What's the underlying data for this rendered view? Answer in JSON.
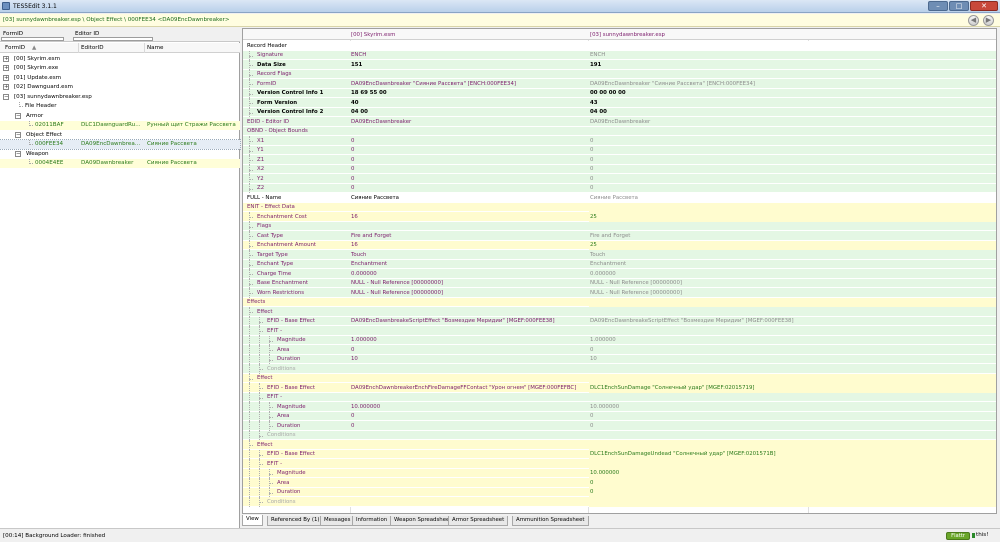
{
  "window": {
    "title": "TES5Edit 3.1.1",
    "min_label": "–",
    "max_label": "□",
    "close_label": "✕"
  },
  "pathbar": {
    "text": "[03] sunnydawnbreaker.esp \\ Object Effect \\ 000FEE34 <DA09EncDawnbreaker>",
    "back_label": "◀",
    "forward_label": "▶"
  },
  "filters": {
    "formid_label": "FormID",
    "editorid_label": "Editor ID",
    "formid_value": "",
    "editorid_value": ""
  },
  "tree_headers": {
    "formid": "FormID",
    "editorid": "EditorID",
    "name": "Name"
  },
  "tree": [
    {
      "formid": "[00] Skyrim.esm",
      "editorid": "",
      "name": "",
      "exp": "+"
    },
    {
      "formid": "[00] Skyrim.exe",
      "editorid": "",
      "name": "",
      "exp": "+"
    },
    {
      "formid": "[01] Update.esm",
      "editorid": "",
      "name": "",
      "exp": "+"
    },
    {
      "formid": "[02] Dawnguard.esm",
      "editorid": "",
      "name": "",
      "exp": "+"
    },
    {
      "formid": "[03] sunnydawnbreaker.esp",
      "editorid": "",
      "name": "",
      "exp": "−"
    },
    {
      "formid": "File Header",
      "editorid": "",
      "name": "",
      "exp": ""
    },
    {
      "formid": "Armor",
      "editorid": "",
      "name": "",
      "exp": "−"
    },
    {
      "formid": "02011BAF",
      "editorid": "DLC1DawnguardRu...",
      "name": "Рунный щит Стражи Рассвета",
      "exp": ""
    },
    {
      "formid": "Object Effect",
      "editorid": "",
      "name": "",
      "exp": "−"
    },
    {
      "formid": "000FEE34",
      "editorid": "DA09EncDawnbrea...",
      "name": "Сияние Рассвета",
      "exp": ""
    },
    {
      "formid": "Weapon",
      "editorid": "",
      "name": "",
      "exp": "−"
    },
    {
      "formid": "0004E4EE",
      "editorid": "DA09Dawnbreaker",
      "name": "Сияние Рассвета",
      "exp": ""
    }
  ],
  "record_headers": {
    "label": "",
    "file1": "[00] Skyrim.esm",
    "file2": "[03] sunnydawnbreaker.esp"
  },
  "records": [
    {
      "label": "Record Header",
      "v1": "",
      "v2": ""
    },
    {
      "label": "Signature",
      "v1": "ENCH",
      "v2": "ENCH"
    },
    {
      "label": "Data Size",
      "v1": "151",
      "v2": "191"
    },
    {
      "label": "Record Flags",
      "v1": "",
      "v2": ""
    },
    {
      "label": "FormID",
      "v1": "DA09EncDawnbreaker \"Сияние Рассвета\" [ENCH:000FEE34]",
      "v2": "DA09EncDawnbreaker \"Сияние Рассвета\" [ENCH:000FEE34]"
    },
    {
      "label": "Version Control Info 1",
      "v1": "18 69 55 00",
      "v2": "00 00 00 00"
    },
    {
      "label": "Form Version",
      "v1": "40",
      "v2": "43"
    },
    {
      "label": "Version Control Info 2",
      "v1": "04 00",
      "v2": "04 00"
    },
    {
      "label": "EDID - Editor ID",
      "v1": "DA09EncDawnbreaker",
      "v2": "DA09EncDawnbreaker"
    },
    {
      "label": "OBND - Object Bounds",
      "v1": "",
      "v2": ""
    },
    {
      "label": "X1",
      "v1": "0",
      "v2": "0"
    },
    {
      "label": "Y1",
      "v1": "0",
      "v2": "0"
    },
    {
      "label": "Z1",
      "v1": "0",
      "v2": "0"
    },
    {
      "label": "X2",
      "v1": "0",
      "v2": "0"
    },
    {
      "label": "Y2",
      "v1": "0",
      "v2": "0"
    },
    {
      "label": "Z2",
      "v1": "0",
      "v2": "0"
    },
    {
      "label": "FULL - Name",
      "v1": "Сияние Рассвета",
      "v2": "Сияние Рассвета"
    },
    {
      "label": "ENIT - Effect Data",
      "v1": "",
      "v2": ""
    },
    {
      "label": "Enchantment Cost",
      "v1": "16",
      "v2": "25"
    },
    {
      "label": "Flags",
      "v1": "",
      "v2": ""
    },
    {
      "label": "Cast Type",
      "v1": "Fire and Forget",
      "v2": "Fire and Forget"
    },
    {
      "label": "Enchantment Amount",
      "v1": "16",
      "v2": "25"
    },
    {
      "label": "Target Type",
      "v1": "Touch",
      "v2": "Touch"
    },
    {
      "label": "Enchant Type",
      "v1": "Enchantment",
      "v2": "Enchantment"
    },
    {
      "label": "Charge Time",
      "v1": "0.000000",
      "v2": "0.000000"
    },
    {
      "label": "Base Enchantment",
      "v1": "NULL - Null Reference [00000000]",
      "v2": "NULL - Null Reference [00000000]"
    },
    {
      "label": "Worn Restrictions",
      "v1": "NULL - Null Reference [00000000]",
      "v2": "NULL - Null Reference [00000000]"
    },
    {
      "label": "Effects",
      "v1": "",
      "v2": ""
    },
    {
      "label": "Effect",
      "v1": "",
      "v2": ""
    },
    {
      "label": "EFID - Base Effect",
      "v1": "DA09EncDawnbreakeScriptEffect \"Возмездие Меридии\" [MGEF:000FEE38]",
      "v2": "DA09EncDawnbreakeScriptEffect \"Возмездие Меридии\" [MGEF:000FEE38]"
    },
    {
      "label": "EFIT -",
      "v1": "",
      "v2": ""
    },
    {
      "label": "Magnitude",
      "v1": "1.000000",
      "v2": "1.000000"
    },
    {
      "label": "Area",
      "v1": "0",
      "v2": "0"
    },
    {
      "label": "Duration",
      "v1": "10",
      "v2": "10"
    },
    {
      "label": "Conditions",
      "v1": "",
      "v2": ""
    },
    {
      "label": "Effect",
      "v1": "",
      "v2": ""
    },
    {
      "label": "EFID - Base Effect",
      "v1": "DA09EnchDawnbreakerEnchFireDamageFFContact \"Урон огнем\" [MGEF:000FEFBC]",
      "v2": "DLC1EnchSunDamage \"Солнечный удар\" [MGEF:02015719]"
    },
    {
      "label": "EFIT -",
      "v1": "",
      "v2": ""
    },
    {
      "label": "Magnitude",
      "v1": "10.000000",
      "v2": "10.000000"
    },
    {
      "label": "Area",
      "v1": "0",
      "v2": "0"
    },
    {
      "label": "Duration",
      "v1": "0",
      "v2": "0"
    },
    {
      "label": "Conditions",
      "v1": "",
      "v2": ""
    },
    {
      "label": "Effect",
      "v1": "",
      "v2": ""
    },
    {
      "label": "EFID - Base Effect",
      "v1": "",
      "v2": "DLC1EnchSunDamageUndead \"Солнечный удар\" [MGEF:0201571B]"
    },
    {
      "label": "EFIT -",
      "v1": "",
      "v2": ""
    },
    {
      "label": "Magnitude",
      "v1": "",
      "v2": "10.000000"
    },
    {
      "label": "Area",
      "v1": "",
      "v2": "0"
    },
    {
      "label": "Duration",
      "v1": "",
      "v2": "0"
    },
    {
      "label": "Conditions",
      "v1": "",
      "v2": ""
    }
  ],
  "tabs": [
    "View",
    "Referenced By (1)",
    "Messages",
    "Information",
    "Weapon Spreadsheet",
    "Armor Spreadsheet",
    "Ammunition Spreadsheet"
  ],
  "status": {
    "text": "[00:14] Background Loader: finished",
    "flattr": "Flattr",
    "this": "this!"
  }
}
